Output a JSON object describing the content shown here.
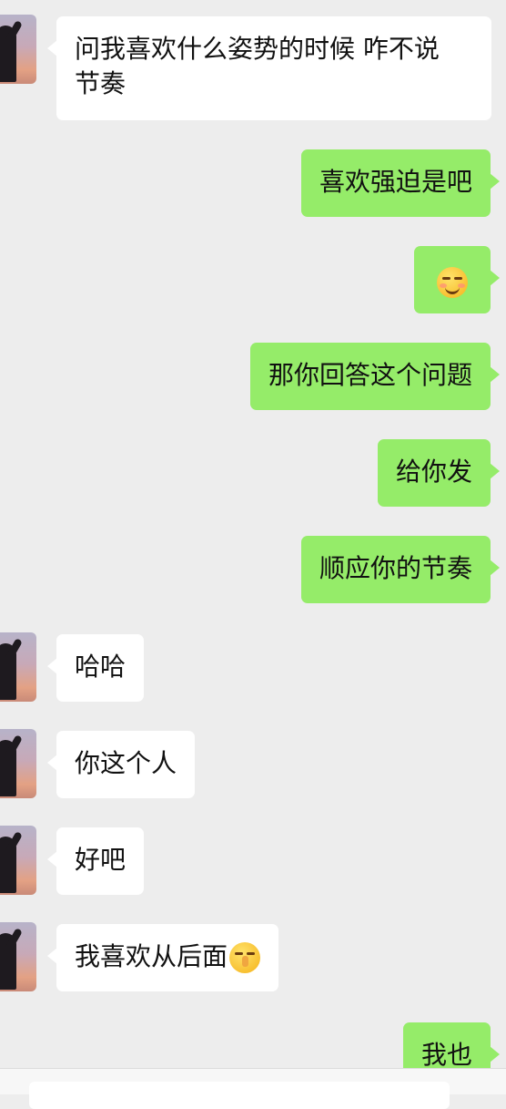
{
  "messages": [
    {
      "side": "in",
      "text": "问我喜欢什么姿势的时候 咋不说\n节奏"
    },
    {
      "side": "out",
      "text": "喜欢强迫是吧"
    },
    {
      "side": "out",
      "emoji": "smirk-emoji"
    },
    {
      "side": "out",
      "text": "那你回答这个问题"
    },
    {
      "side": "out",
      "text": "给你发"
    },
    {
      "side": "out",
      "text": "顺应你的节奏"
    },
    {
      "side": "in",
      "text": "哈哈"
    },
    {
      "side": "in",
      "text": "你这个人"
    },
    {
      "side": "in",
      "text": "好吧"
    },
    {
      "side": "in",
      "text": "我喜欢从后面",
      "emoji": "shush-emoji"
    },
    {
      "side": "out",
      "text": "我也"
    }
  ],
  "colors": {
    "background": "#ededed",
    "incoming_bubble": "#ffffff",
    "outgoing_bubble": "#95ec69"
  }
}
